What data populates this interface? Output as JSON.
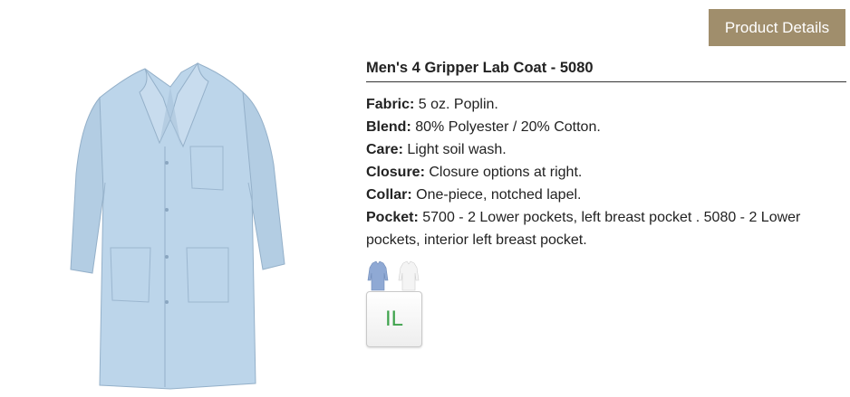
{
  "header": {
    "details_button_label": "Product Details"
  },
  "product": {
    "title": "Men's 4 Gripper Lab Coat - 5080",
    "image_icon": "lab-coat-image",
    "specs": [
      {
        "label": "Fabric:",
        "value": "5 oz. Poplin."
      },
      {
        "label": "Blend:",
        "value": "80% Polyester / 20% Cotton."
      },
      {
        "label": "Care:",
        "value": "Light soil wash."
      },
      {
        "label": "Closure:",
        "value": "Closure options at right."
      },
      {
        "label": "Collar:",
        "value": "One-piece, notched lapel."
      },
      {
        "label": "Pocket:",
        "value": "5700 - 2 Lower pockets, left breast pocket . 5080 - 2 Lower pockets, interior left breast pocket."
      }
    ],
    "swatches": [
      {
        "name": "light-blue",
        "color": "#8fa9d4"
      },
      {
        "name": "white",
        "color": "#f4f4f4"
      }
    ],
    "badge_label": "IL"
  },
  "colors": {
    "button_bg": "#a08e6c",
    "coat": "#b9d3e8",
    "badge_text": "#3fa34d"
  }
}
